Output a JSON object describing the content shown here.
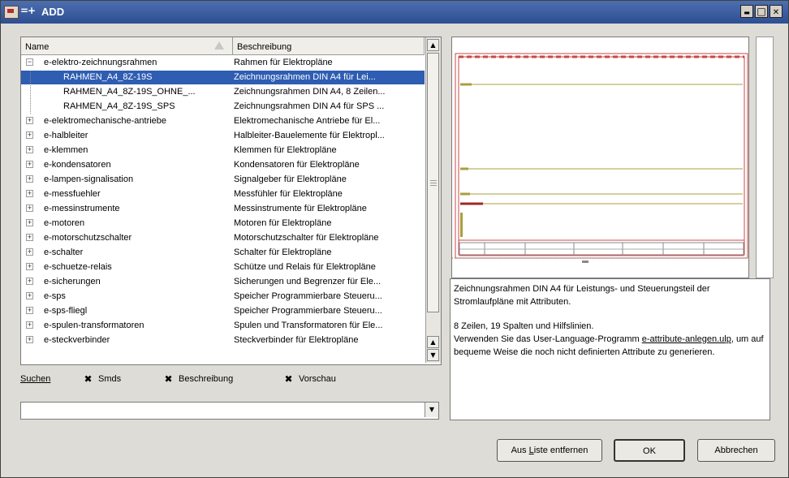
{
  "window": {
    "title": "ADD",
    "title_glyph": "=+",
    "minimize": "▬",
    "maximize": "□",
    "close": "✕"
  },
  "list": {
    "columns": [
      "Name",
      "Beschreibung"
    ],
    "rows": [
      {
        "name": "e-elektro-zeichnungsrahmen",
        "desc": "Rahmen für Elektropläne",
        "level": 0,
        "expander": "−"
      },
      {
        "name": "RAHMEN_A4_8Z-19S",
        "desc": "Zeichnungsrahmen DIN A4  für Lei...",
        "level": 1,
        "selected": true
      },
      {
        "name": "RAHMEN_A4_8Z-19S_OHNE_...",
        "desc": "Zeichnungsrahmen DIN A4, 8 Zeilen...",
        "level": 1
      },
      {
        "name": "RAHMEN_A4_8Z-19S_SPS",
        "desc": "Zeichnungsrahmen DIN A4 für SPS ...",
        "level": 1
      },
      {
        "name": "e-elektromechanische-antriebe",
        "desc": "Elektromechanische Antriebe  für El...",
        "level": 0,
        "expander": "+"
      },
      {
        "name": "e-halbleiter",
        "desc": "Halbleiter-Bauelemente für Elektropl...",
        "level": 0,
        "expander": "+"
      },
      {
        "name": "e-klemmen",
        "desc": "Klemmen für Elektropläne",
        "level": 0,
        "expander": "+"
      },
      {
        "name": "e-kondensatoren",
        "desc": "Kondensatoren für Elektropläne",
        "level": 0,
        "expander": "+"
      },
      {
        "name": "e-lampen-signalisation",
        "desc": "Signalgeber für Elektropläne",
        "level": 0,
        "expander": "+"
      },
      {
        "name": "e-messfuehler",
        "desc": "Messfühler für Elektropläne",
        "level": 0,
        "expander": "+"
      },
      {
        "name": "e-messinstrumente",
        "desc": "Messinstrumente für Elektropläne",
        "level": 0,
        "expander": "+"
      },
      {
        "name": "e-motoren",
        "desc": "Motoren für Elektropläne",
        "level": 0,
        "expander": "+"
      },
      {
        "name": "e-motorschutzschalter",
        "desc": "Motorschutzschalter für Elektropläne",
        "level": 0,
        "expander": "+"
      },
      {
        "name": "e-schalter",
        "desc": "Schalter für Elektropläne",
        "level": 0,
        "expander": "+"
      },
      {
        "name": "e-schuetze-relais",
        "desc": "Schütze und Relais für Elektropläne",
        "level": 0,
        "expander": "+"
      },
      {
        "name": "e-sicherungen",
        "desc": "Sicherungen und Begrenzer für Ele...",
        "level": 0,
        "expander": "+"
      },
      {
        "name": "e-sps",
        "desc": "Speicher Programmierbare Steueru...",
        "level": 0,
        "expander": "+"
      },
      {
        "name": "e-sps-fliegl",
        "desc": "Speicher Programmierbare Steueru...",
        "level": 0,
        "expander": "+"
      },
      {
        "name": "e-spulen-transformatoren",
        "desc": "Spulen und Transformatoren für Ele...",
        "level": 0,
        "expander": "+"
      },
      {
        "name": "e-steckverbinder",
        "desc": "Steckverbinder für Elektropläne",
        "level": 0,
        "expander": "+"
      }
    ]
  },
  "search": {
    "label": "Suchen",
    "smds_label": "Smds",
    "smds_checked": "✖",
    "desc_label": "Beschreibung",
    "desc_checked": "✖",
    "preview_label": "Vorschau",
    "preview_checked": "✖",
    "combo_value": "",
    "combo_arrow": "▼"
  },
  "scroll": {
    "up": "▲",
    "down": "▼"
  },
  "description": {
    "line1": "Zeichnungsrahmen DIN A4 für Leistungs- und Steuerungsteil der Stromlaufpläne mit Attributen.",
    "line2": "8 Zeilen, 19 Spalten und Hilfslinien.",
    "line3_pre": "Verwenden Sie das User-Language-Programm ",
    "line3_link": "e-attribute-anlegen.ulp",
    "line3_post": ", um auf bequeme Weise die noch nicht definierten Attribute zu generieren."
  },
  "buttons": {
    "remove_pre": "Aus ",
    "remove_u": "L",
    "remove_post": "iste entfernen",
    "ok": "OK",
    "cancel": "Abbrechen"
  },
  "colors": {
    "selection": "#2e5db2",
    "frame_red": "#c84848",
    "olive": "#a8a03c",
    "title_blue": "#3d5fa2"
  }
}
